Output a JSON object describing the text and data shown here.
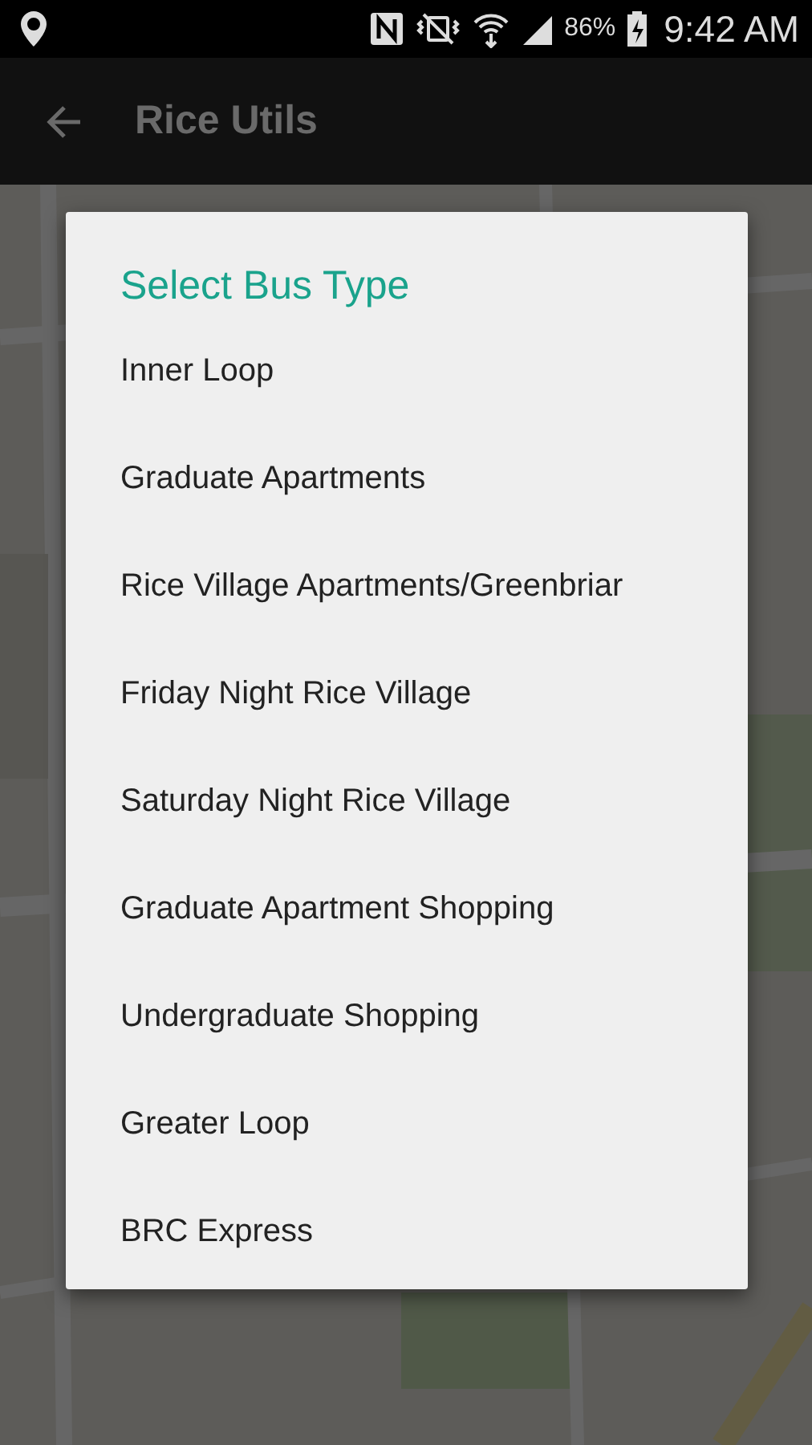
{
  "status_bar": {
    "battery": "86%",
    "time": "9:42 AM"
  },
  "app_bar": {
    "title": "Rice Utils"
  },
  "dialog": {
    "title": "Select Bus Type",
    "items": [
      {
        "label": "Inner Loop"
      },
      {
        "label": "Graduate Apartments"
      },
      {
        "label": "Rice Village Apartments/Greenbriar"
      },
      {
        "label": "Friday Night Rice Village"
      },
      {
        "label": "Saturday Night Rice Village"
      },
      {
        "label": "Graduate Apartment Shopping"
      },
      {
        "label": "Undergraduate Shopping"
      },
      {
        "label": "Greater Loop"
      },
      {
        "label": "BRC Express"
      }
    ]
  }
}
